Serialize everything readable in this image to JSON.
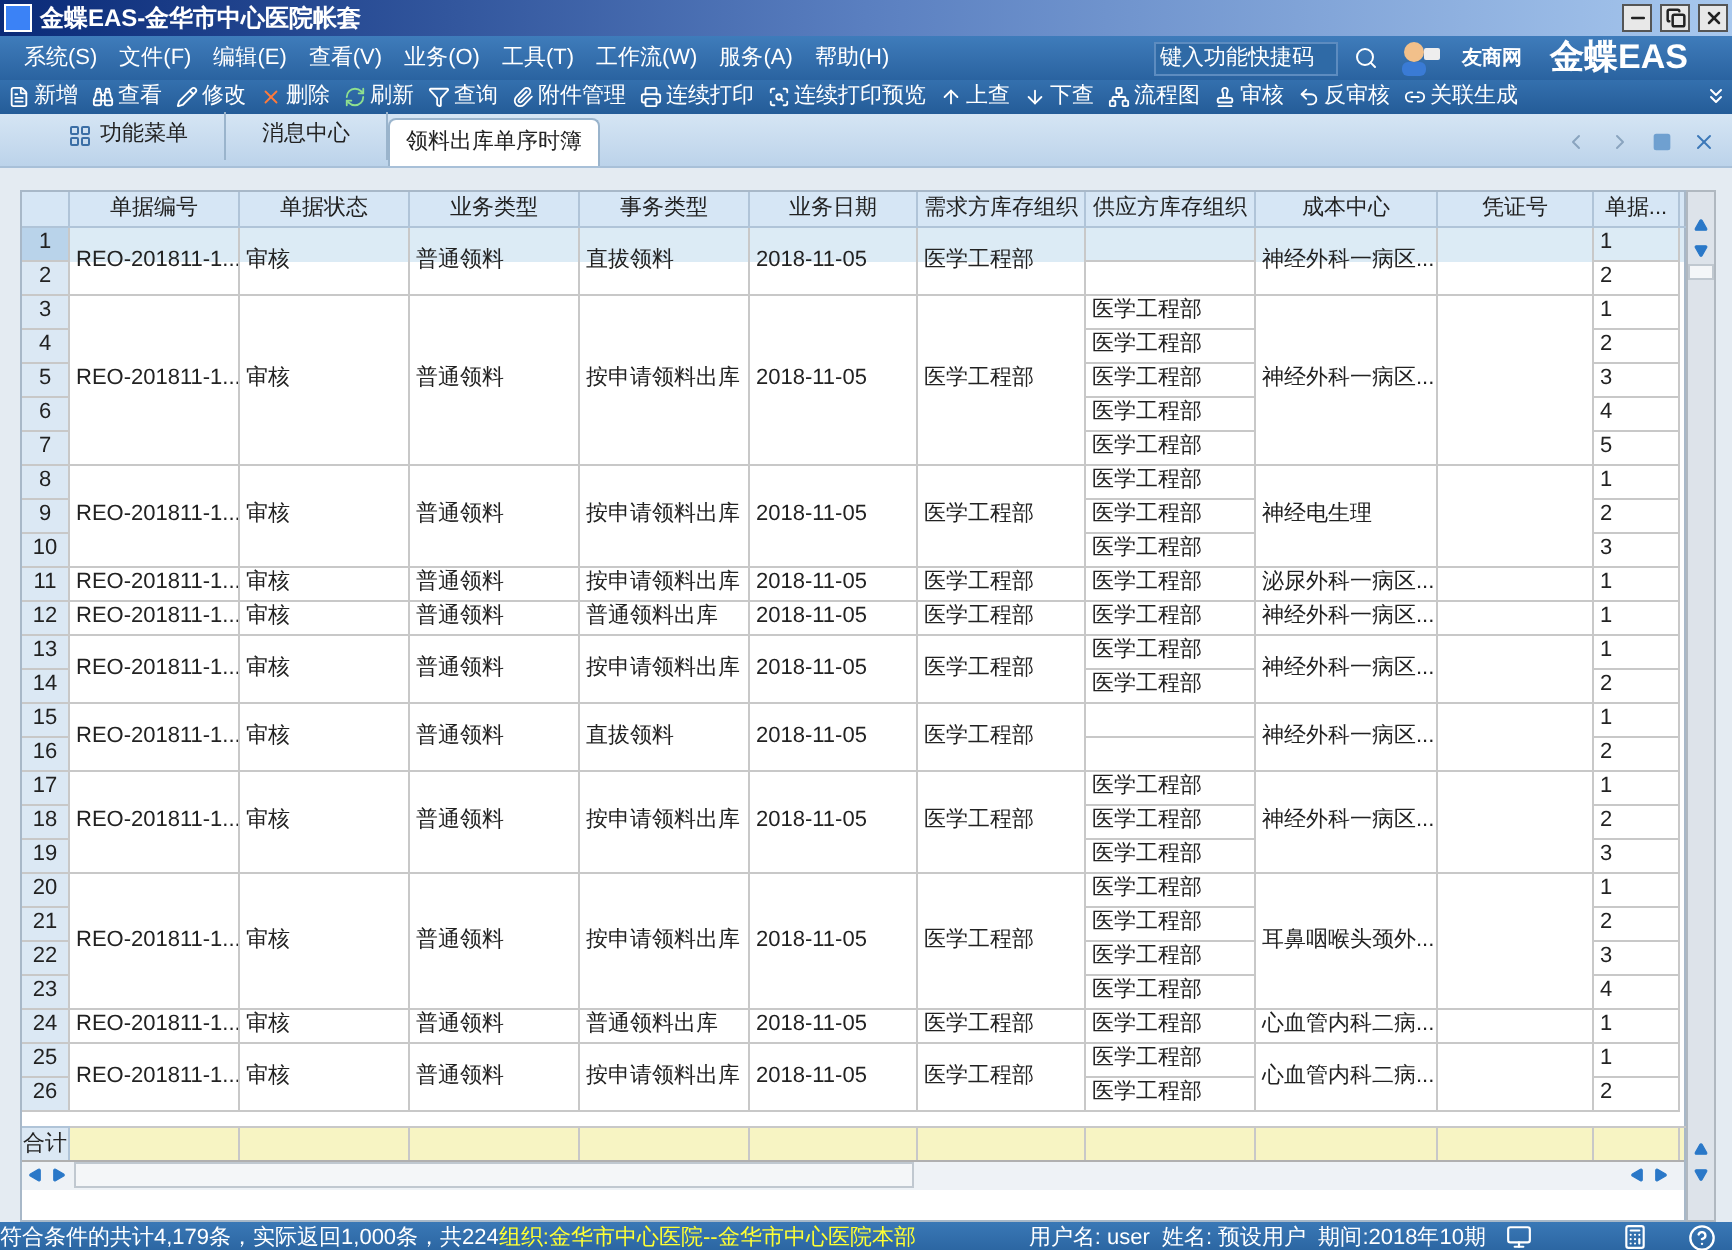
{
  "window": {
    "title": "金蝶EAS-金华市中心医院帐套"
  },
  "menu": [
    "系统(S)",
    "文件(F)",
    "编辑(E)",
    "查看(V)",
    "业务(O)",
    "工具(T)",
    "工作流(W)",
    "服务(A)",
    "帮助(H)"
  ],
  "quick_search": {
    "placeholder": "键入功能快捷码"
  },
  "brand": {
    "partner": "友商网",
    "logo": "金蝶EAS"
  },
  "toolbar": [
    {
      "label": "新增",
      "kind": "new"
    },
    {
      "label": "查看",
      "kind": "view"
    },
    {
      "label": "修改",
      "kind": "edit"
    },
    {
      "label": "删除",
      "kind": "delete"
    },
    {
      "label": "刷新",
      "kind": "refresh"
    },
    {
      "label": "查询",
      "kind": "filter"
    },
    {
      "label": "附件管理",
      "kind": "attach"
    },
    {
      "label": "连续打印",
      "kind": "print"
    },
    {
      "label": "连续打印预览",
      "kind": "preview"
    },
    {
      "label": "上查",
      "kind": "up"
    },
    {
      "label": "下查",
      "kind": "down"
    },
    {
      "label": "流程图",
      "kind": "flow"
    },
    {
      "label": "审核",
      "kind": "audit"
    },
    {
      "label": "反审核",
      "kind": "unaudit"
    },
    {
      "label": "关联生成",
      "kind": "link"
    }
  ],
  "tabs": [
    {
      "label": "功能菜单",
      "selected": false
    },
    {
      "label": "消息中心",
      "selected": false
    },
    {
      "label": "领料出库单序时簿",
      "selected": true
    }
  ],
  "table": {
    "columns": [
      "单据编号",
      "单据状态",
      "业务类型",
      "事务类型",
      "业务日期",
      "需求方库存组织",
      "供应方库存组织",
      "成本中心",
      "凭证号",
      "单据..."
    ],
    "groups": [
      {
        "doc_no": "REO-201811-1...",
        "status": "审核",
        "biz_type": "普通领料",
        "txn_type": "直拔领料",
        "date": "2018-11-05",
        "demand_org": "医学工程部",
        "cost_center": "神经外科一病区...",
        "lines": [
          {
            "row": "1",
            "line_no": "1",
            "selected": true
          },
          {
            "row": "2",
            "line_no": "2",
            "selected": false
          }
        ]
      },
      {
        "doc_no": "REO-201811-1...",
        "status": "审核",
        "biz_type": "普通领料",
        "txn_type": "按申请领料出库",
        "date": "2018-11-05",
        "demand_org": "医学工程部",
        "cost_center": "神经外科一病区...",
        "lines": [
          {
            "row": "3",
            "supply_org": "医学工程部",
            "line_no": "1",
            "selected": false
          },
          {
            "row": "4",
            "supply_org": "医学工程部",
            "line_no": "2",
            "selected": false
          },
          {
            "row": "5",
            "supply_org": "医学工程部",
            "line_no": "3",
            "selected": false
          },
          {
            "row": "6",
            "supply_org": "医学工程部",
            "line_no": "4",
            "selected": false
          },
          {
            "row": "7",
            "supply_org": "医学工程部",
            "line_no": "5",
            "selected": false
          }
        ]
      },
      {
        "doc_no": "REO-201811-1...",
        "status": "审核",
        "biz_type": "普通领料",
        "txn_type": "按申请领料出库",
        "date": "2018-11-05",
        "demand_org": "医学工程部",
        "cost_center": "神经电生理",
        "lines": [
          {
            "row": "8",
            "supply_org": "医学工程部",
            "line_no": "1",
            "selected": false
          },
          {
            "row": "9",
            "supply_org": "医学工程部",
            "line_no": "2",
            "selected": false
          },
          {
            "row": "10",
            "supply_org": "医学工程部",
            "line_no": "3",
            "selected": false
          }
        ]
      },
      {
        "doc_no": "REO-201811-1...",
        "status": "审核",
        "biz_type": "普通领料",
        "txn_type": "按申请领料出库",
        "date": "2018-11-05",
        "demand_org": "医学工程部",
        "cost_center": "泌尿外科一病区...",
        "lines": [
          {
            "row": "11",
            "supply_org": "医学工程部",
            "line_no": "1",
            "selected": false
          }
        ]
      },
      {
        "doc_no": "REO-201811-1...",
        "status": "审核",
        "biz_type": "普通领料",
        "txn_type": "普通领料出库",
        "date": "2018-11-05",
        "demand_org": "医学工程部",
        "cost_center": "神经外科一病区...",
        "lines": [
          {
            "row": "12",
            "supply_org": "医学工程部",
            "line_no": "1",
            "selected": false
          }
        ]
      },
      {
        "doc_no": "REO-201811-1...",
        "status": "审核",
        "biz_type": "普通领料",
        "txn_type": "按申请领料出库",
        "date": "2018-11-05",
        "demand_org": "医学工程部",
        "cost_center": "神经外科一病区...",
        "lines": [
          {
            "row": "13",
            "supply_org": "医学工程部",
            "line_no": "1",
            "selected": false
          },
          {
            "row": "14",
            "supply_org": "医学工程部",
            "line_no": "2",
            "selected": false
          }
        ]
      },
      {
        "doc_no": "REO-201811-1...",
        "status": "审核",
        "biz_type": "普通领料",
        "txn_type": "直拔领料",
        "date": "2018-11-05",
        "demand_org": "医学工程部",
        "cost_center": "神经外科一病区...",
        "lines": [
          {
            "row": "15",
            "line_no": "1",
            "selected": false
          },
          {
            "row": "16",
            "line_no": "2",
            "selected": false
          }
        ]
      },
      {
        "doc_no": "REO-201811-1...",
        "status": "审核",
        "biz_type": "普通领料",
        "txn_type": "按申请领料出库",
        "date": "2018-11-05",
        "demand_org": "医学工程部",
        "cost_center": "神经外科一病区...",
        "lines": [
          {
            "row": "17",
            "supply_org": "医学工程部",
            "line_no": "1",
            "selected": false
          },
          {
            "row": "18",
            "supply_org": "医学工程部",
            "line_no": "2",
            "selected": false
          },
          {
            "row": "19",
            "supply_org": "医学工程部",
            "line_no": "3",
            "selected": false
          }
        ]
      },
      {
        "doc_no": "REO-201811-1...",
        "status": "审核",
        "biz_type": "普通领料",
        "txn_type": "按申请领料出库",
        "date": "2018-11-05",
        "demand_org": "医学工程部",
        "cost_center": "耳鼻咽喉头颈外...",
        "lines": [
          {
            "row": "20",
            "supply_org": "医学工程部",
            "line_no": "1",
            "selected": false
          },
          {
            "row": "21",
            "supply_org": "医学工程部",
            "line_no": "2",
            "selected": false
          },
          {
            "row": "22",
            "supply_org": "医学工程部",
            "line_no": "3",
            "selected": false
          },
          {
            "row": "23",
            "supply_org": "医学工程部",
            "line_no": "4",
            "selected": false
          }
        ]
      },
      {
        "doc_no": "REO-201811-1...",
        "status": "审核",
        "biz_type": "普通领料",
        "txn_type": "普通领料出库",
        "date": "2018-11-05",
        "demand_org": "医学工程部",
        "cost_center": "心血管内科二病...",
        "lines": [
          {
            "row": "24",
            "supply_org": "医学工程部",
            "line_no": "1",
            "selected": false
          }
        ]
      },
      {
        "doc_no": "REO-201811-1...",
        "status": "审核",
        "biz_type": "普通领料",
        "txn_type": "按申请领料出库",
        "date": "2018-11-05",
        "demand_org": "医学工程部",
        "cost_center": "心血管内科二病...",
        "lines": [
          {
            "row": "25",
            "supply_org": "医学工程部",
            "line_no": "1",
            "selected": false
          },
          {
            "row": "26",
            "supply_org": "医学工程部",
            "line_no": "2",
            "selected": false
          }
        ]
      }
    ],
    "total_label": "合计"
  },
  "status_bar": {
    "summary": "符合条件的共计4,179条，实际返回1,000条，共224",
    "org": "组织:金华市中心医院--金华市中心医院本部",
    "user": "用户名: user  姓名: 预设用户  期间:2018年10期"
  }
}
